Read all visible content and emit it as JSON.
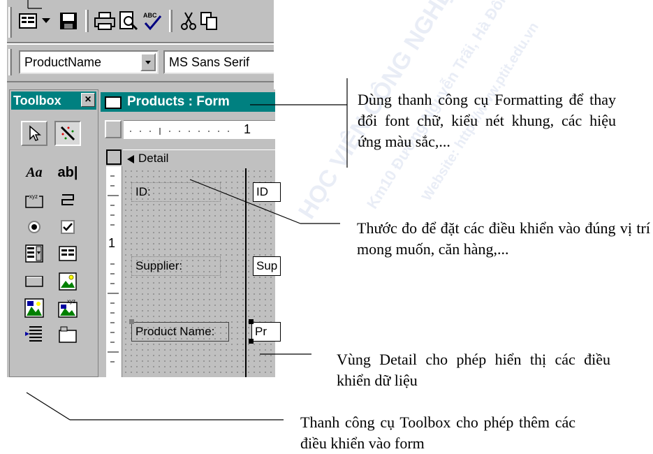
{
  "toolbar": {
    "buttons": [
      {
        "name": "form-view-icon"
      },
      {
        "name": "dropdown-arrow-icon"
      },
      {
        "name": "save-icon"
      },
      {
        "name": "print-icon"
      },
      {
        "name": "print-preview-icon"
      },
      {
        "name": "spelling-icon",
        "label": "ABC"
      },
      {
        "name": "cut-icon"
      },
      {
        "name": "copy-icon"
      }
    ]
  },
  "formatting": {
    "object_combo": "ProductName",
    "font_combo": "MS Sans Serif"
  },
  "toolbox": {
    "title": "Toolbox",
    "close": "×",
    "tools": [
      {
        "name": "select-objects-icon"
      },
      {
        "name": "control-wizards-icon"
      },
      {
        "name": "label-tool-icon",
        "label": "Aa"
      },
      {
        "name": "text-box-tool-icon",
        "label": "ab|"
      },
      {
        "name": "option-group-tool-icon",
        "label": "xyz"
      },
      {
        "name": "toggle-button-tool-icon"
      },
      {
        "name": "option-button-tool-icon"
      },
      {
        "name": "check-box-tool-icon"
      },
      {
        "name": "combo-box-tool-icon"
      },
      {
        "name": "list-box-tool-icon"
      },
      {
        "name": "command-button-tool-icon"
      },
      {
        "name": "image-tool-icon"
      },
      {
        "name": "unbound-object-frame-tool-icon"
      },
      {
        "name": "bound-object-frame-tool-icon"
      },
      {
        "name": "page-break-tool-icon"
      },
      {
        "name": "tab-control-tool-icon"
      }
    ]
  },
  "form_window": {
    "title": "Products : Form",
    "ruler_label": "1",
    "vruler_label": "1",
    "section": "Detail",
    "fields": [
      {
        "label": "ID:",
        "value": "ID"
      },
      {
        "label": "Supplier:",
        "value": "Sup"
      },
      {
        "label": "Product Name:",
        "value": "Pr"
      }
    ]
  },
  "annotations": {
    "formatting": "Dùng thanh công cụ Formatting để thay đổi font chữ, kiểu nét khung, các hiệu ứng màu sắc,...",
    "ruler": "Thước đo để đặt các điều khiển vào đúng vị trí mong muốn, căn hàng,...",
    "detail": "Vùng Detail cho phép hiển thị các điều khiển dữ liệu",
    "toolbox": "Thanh công cụ Toolbox cho phép thêm các điều khiển vào form"
  },
  "colors": {
    "title_bar": "#008080",
    "panel": "#c0c0c0"
  }
}
